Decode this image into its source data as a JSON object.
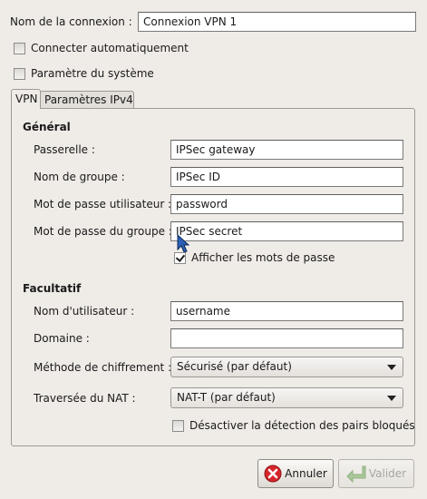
{
  "connection": {
    "name_label": "Nom de la connexion :",
    "name_value": "Connexion VPN 1",
    "auto_connect_label": "Connecter automatiquement",
    "auto_connect_checked": false,
    "system_setting_label": "Paramètre du système",
    "system_setting_checked": false
  },
  "tabs": [
    {
      "label": "VPN",
      "active": true
    },
    {
      "label": "Paramètres IPv4",
      "active": false
    }
  ],
  "general": {
    "heading": "Général",
    "gateway_label": "Passerelle :",
    "gateway_value": "IPSec gateway",
    "group_name_label": "Nom de groupe :",
    "group_name_value": "IPSec ID",
    "user_password_label": "Mot de passe utilisateur :",
    "user_password_value": "password",
    "group_password_label": "Mot de passe du groupe :",
    "group_password_value": "IPSec secret",
    "show_passwords_label": "Afficher les mots de passe",
    "show_passwords_checked": true
  },
  "optional": {
    "heading": "Facultatif",
    "username_label": "Nom d'utilisateur :",
    "username_value": "username",
    "domain_label": "Domaine :",
    "domain_value": "",
    "encryption_label": "Méthode de chiffrement :",
    "encryption_value": "Sécurisé (par défaut)",
    "nat_label": "Traversée du NAT :",
    "nat_value": "NAT-T (par défaut)",
    "disable_dpd_label": "Désactiver la détection des pairs bloqués",
    "disable_dpd_checked": false
  },
  "buttons": {
    "cancel_label": "Annuler",
    "apply_label": "Valider"
  },
  "colors": {
    "window_bg": "#efebe7",
    "cancel_icon": "#d6262b",
    "apply_icon_disabled": "#a9c79a"
  }
}
